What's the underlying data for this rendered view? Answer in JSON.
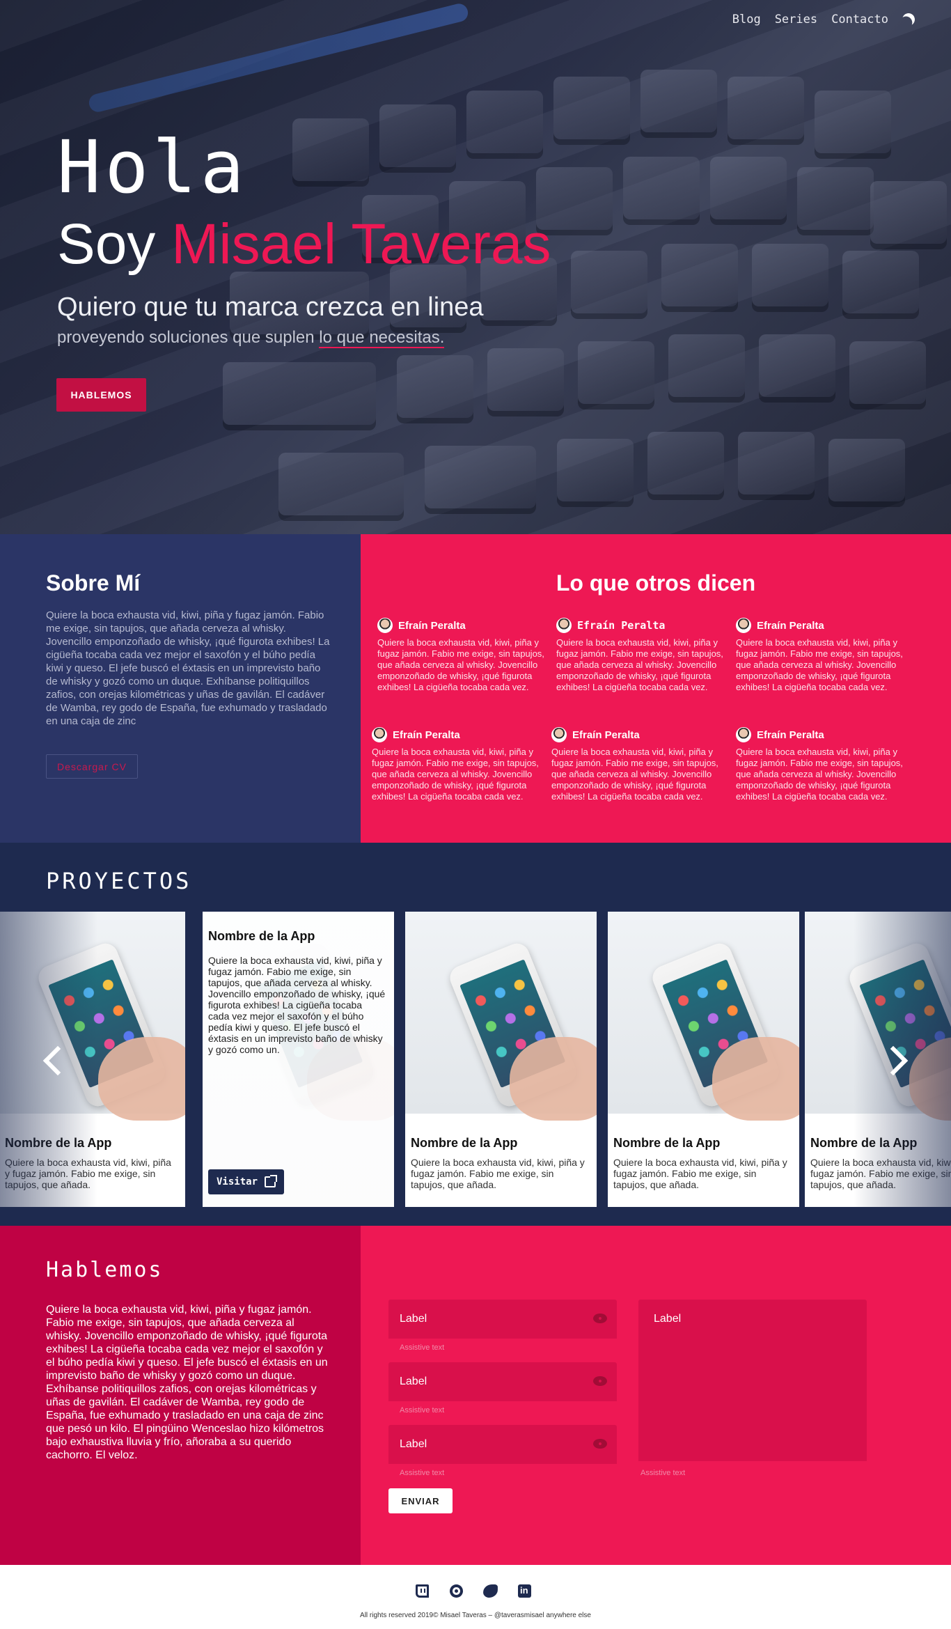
{
  "nav": {
    "items": [
      "Blog",
      "Series",
      "Contacto"
    ],
    "theme_icon": "moon-icon"
  },
  "hero": {
    "greeting": "Hola",
    "soy": "Soy",
    "name": "Misael Taveras",
    "tagline": "Quiero que tu marca crezca en linea",
    "sub_prefix": "proveyendo soluciones que suplen ",
    "sub_highlight": "lo que necesitas.",
    "cta": "HABLEMOS",
    "accent": "#ee1854"
  },
  "about": {
    "title": "Sobre Mí",
    "text": "Quiere la boca exhausta vid, kiwi, piña y fugaz jamón. Fabio me exige, sin tapujos, que añada cerveza al whisky. Jovencillo emponzoñado de whisky, ¡qué figurota exhibes! La cigüeña tocaba cada vez mejor el saxofón y el búho pedía kiwi y queso. El jefe buscó el éxtasis en un imprevisto baño de whisky y gozó como un duque. Exhíbanse politiquillos zafios, con orejas kilométricas y uñas de gavilán. El cadáver de Wamba, rey godo de España, fue exhumado y trasladado en una caja de zinc",
    "cv_button": "Descargar CV"
  },
  "testimonials": {
    "title": "Lo que otros dicen",
    "items": [
      {
        "name": "Efraín Peralta",
        "text": "Quiere la boca exhausta vid, kiwi, piña y fugaz jamón. Fabio me exige, sin tapujos, que añada cerveza al whisky. Jovencillo emponzoñado de whisky, ¡qué figurota exhibes! La cigüeña tocaba cada vez."
      },
      {
        "name": "Efraín Peralta",
        "text": "Quiere la boca exhausta vid, kiwi, piña y fugaz jamón. Fabio me exige, sin tapujos, que añada cerveza al whisky. Jovencillo emponzoñado de whisky, ¡qué figurota exhibes! La cigüeña tocaba cada vez."
      },
      {
        "name": "Efraín Peralta",
        "text": "Quiere la boca exhausta vid, kiwi, piña y fugaz jamón. Fabio me exige, sin tapujos, que añada cerveza al whisky. Jovencillo emponzoñado de whisky, ¡qué figurota exhibes! La cigüeña tocaba cada vez."
      },
      {
        "name": "Efraín Peralta",
        "text": "Quiere la boca exhausta vid, kiwi, piña y fugaz jamón. Fabio me exige, sin tapujos, que añada cerveza al whisky. Jovencillo emponzoñado de whisky, ¡qué figurota exhibes! La cigüeña tocaba cada vez."
      },
      {
        "name": "Efraín Peralta",
        "text": "Quiere la boca exhausta vid, kiwi, piña y fugaz jamón. Fabio me exige, sin tapujos, que añada cerveza al whisky. Jovencillo emponzoñado de whisky, ¡qué figurota exhibes! La cigüeña tocaba cada vez."
      },
      {
        "name": "Efraín Peralta",
        "text": "Quiere la boca exhausta vid, kiwi, piña y fugaz jamón. Fabio me exige, sin tapujos, que añada cerveza al whisky. Jovencillo emponzoñado de whisky, ¡qué figurota exhibes! La cigüeña tocaba cada vez."
      }
    ]
  },
  "projects": {
    "title": "PROYECTOS",
    "cards": [
      {
        "title": "Nombre de la App",
        "text": "Quiere la boca exhausta vid, kiwi, piña y fugaz jamón. Fabio me exige, sin tapujos, que añada."
      },
      {
        "title": "Nombre de la App",
        "text": "Quiere la boca exhausta vid, kiwi, piña y fugaz jamón. Fabio me exige, sin tapujos, que añada cerveza al whisky. Jovencillo emponzoñado de whisky, ¡qué figurota exhibes! La cigüeña tocaba cada vez mejor el saxofón y el búho pedía kiwi y queso. El jefe buscó el éxtasis en un imprevisto baño de whisky y gozó como un.",
        "button": "Visitar"
      },
      {
        "title": "Nombre de la App",
        "text": "Quiere la boca exhausta vid, kiwi, piña y fugaz jamón. Fabio me exige, sin tapujos, que añada."
      },
      {
        "title": "Nombre de la App",
        "text": "Quiere la boca exhausta vid, kiwi, piña y fugaz jamón. Fabio me exige, sin tapujos, que añada."
      },
      {
        "title": "Nombre de la App",
        "text": "Quiere la boca exhausta vid, kiwi, piña y fugaz jamón. Fabio me exige, sin tapujos, que añada."
      }
    ]
  },
  "contact": {
    "title": "Hablemos",
    "text": "Quiere la boca exhausta vid, kiwi, piña y fugaz jamón. Fabio me exige, sin tapujos, que añada cerveza al whisky. Jovencillo emponzoñado de whisky, ¡qué figurota exhibes! La cigüeña tocaba cada vez mejor el saxofón y el búho pedía kiwi y queso. El jefe buscó el éxtasis en un imprevisto baño de whisky y gozó como un duque. Exhíbanse politiquillos zafios, con orejas kilométricas y uñas de gavilán. El cadáver de Wamba, rey godo de España, fue exhumado y trasladado en una caja de zinc que pesó un kilo. El pingüino Wenceslao hizo kilómetros bajo exhaustiva lluvia y frío, añoraba a su querido cachorro. El veloz.",
    "fields": [
      {
        "label": "Label",
        "assist": "Assistive text"
      },
      {
        "label": "Label",
        "assist": "Assistive text"
      },
      {
        "label": "Label",
        "assist": "Assistive text"
      }
    ],
    "message": {
      "label": "Label",
      "assist": "Assistive text"
    },
    "submit": "ENVIAR"
  },
  "footer": {
    "social": [
      "twitch-icon",
      "github-icon",
      "twitter-icon",
      "linkedin-icon"
    ],
    "copyright": "All rights reserved 2019© Misael Taveras – @taverasmisael anywhere else"
  }
}
